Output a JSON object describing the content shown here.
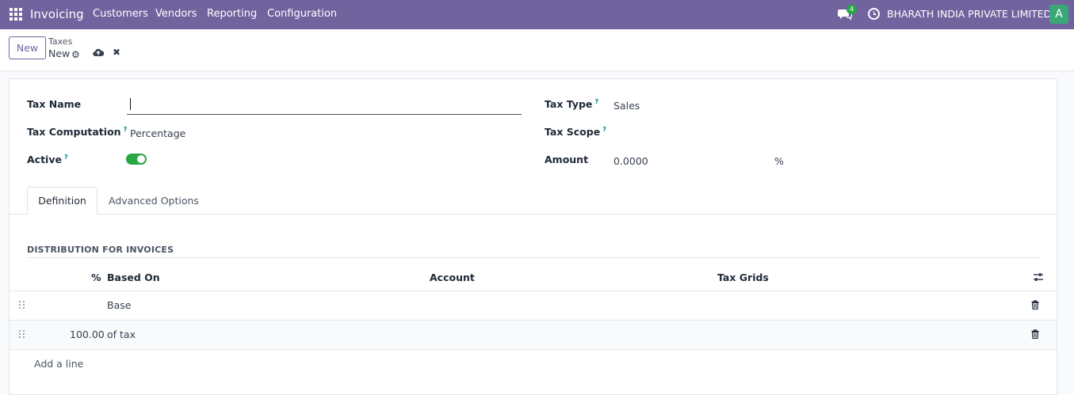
{
  "topbar": {
    "app_name": "Invoicing",
    "menu": [
      "Customers",
      "Vendors",
      "Reporting",
      "Configuration"
    ],
    "chat_count": "4",
    "company": "BHARATH INDIA PRIVATE LIMITED",
    "avatar_letter": "A",
    "color": "#71639e"
  },
  "control": {
    "new_label": "New",
    "breadcrumb_parent": "Taxes",
    "breadcrumb_current": "New"
  },
  "form": {
    "tax_name_label": "Tax Name",
    "tax_name_value": "",
    "tax_computation_label": "Tax Computation",
    "tax_computation_value": "Percentage",
    "active_label": "Active",
    "active_value": true,
    "tax_type_label": "Tax Type",
    "tax_type_value": "Sales",
    "tax_scope_label": "Tax Scope",
    "tax_scope_value": "",
    "amount_label": "Amount",
    "amount_value": "0.0000",
    "amount_unit": "%",
    "help_marker": "?"
  },
  "tabs": [
    {
      "label": "Definition",
      "active": true
    },
    {
      "label": "Advanced Options",
      "active": false
    }
  ],
  "distribution": {
    "title": "DISTRIBUTION FOR INVOICES",
    "columns": [
      "%",
      "Based On",
      "Account",
      "Tax Grids"
    ],
    "rows": [
      {
        "percent": "",
        "based_on": "Base",
        "account": "",
        "tax_grids": ""
      },
      {
        "percent": "100.00",
        "based_on": "of tax",
        "account": "",
        "tax_grids": ""
      }
    ],
    "add_line": "Add a line"
  }
}
